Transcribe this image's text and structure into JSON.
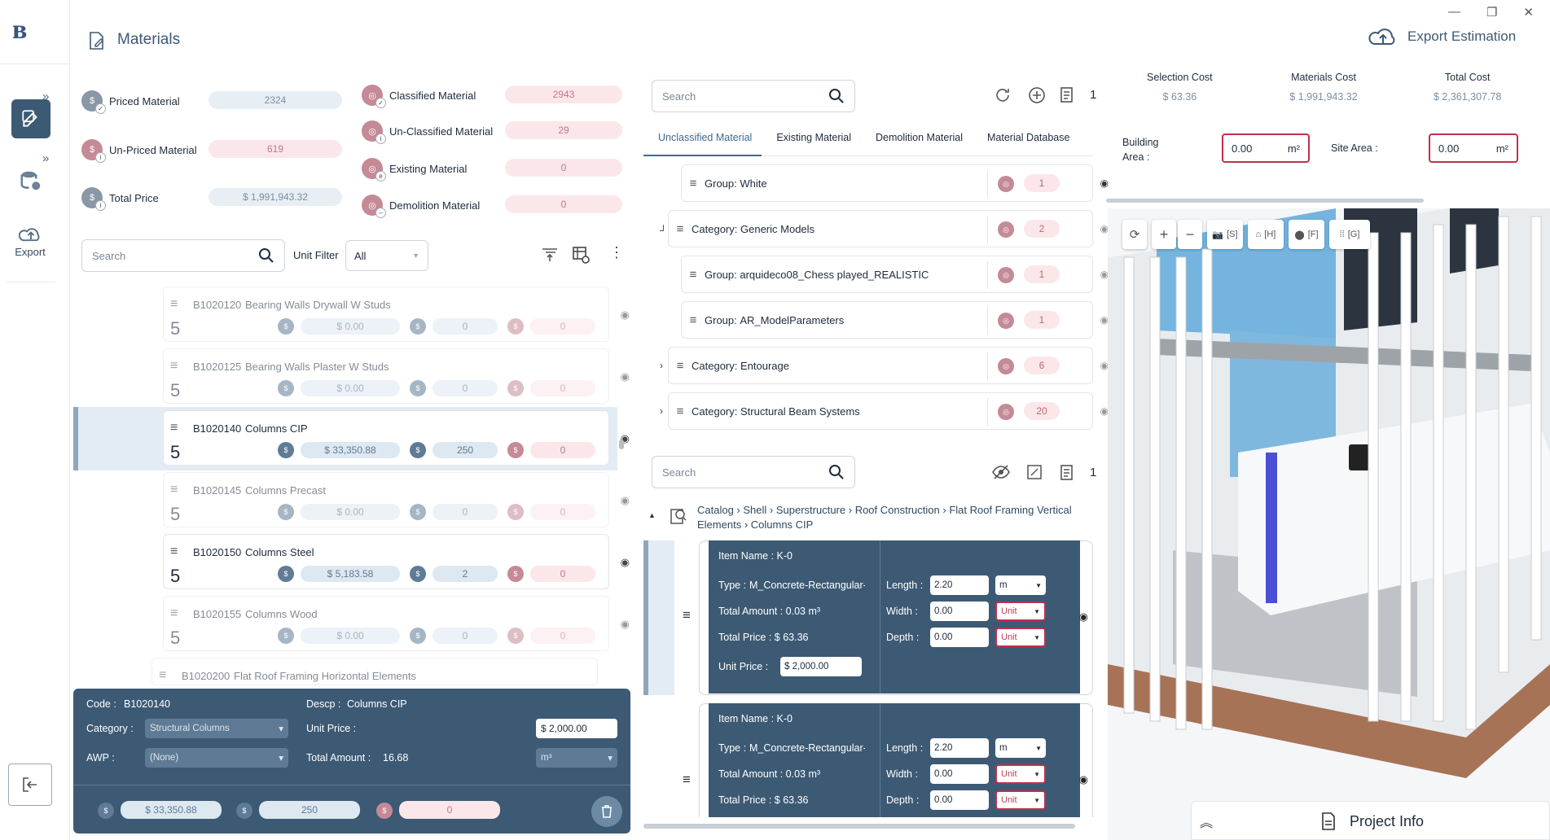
{
  "window": {
    "minimize": "—",
    "restore": "❐",
    "close": "✕"
  },
  "sidebar": {
    "export_label": "Export"
  },
  "header": {
    "title": "Materials",
    "export_label": "Export Estimation"
  },
  "stats": {
    "priced": {
      "label": "Priced Material",
      "value": "2324"
    },
    "unpriced": {
      "label": "Un-Priced Material",
      "value": "619"
    },
    "total_price": {
      "label": "Total Price",
      "value": "$ 1,991,943.32"
    },
    "classified": {
      "label": "Classified Material",
      "value": "2943"
    },
    "unclassified": {
      "label": "Un-Classified Material",
      "value": "29"
    },
    "existing": {
      "label": "Existing Material",
      "value": "0"
    },
    "demolition": {
      "label": "Demolition Material",
      "value": "0"
    }
  },
  "filters": {
    "search_placeholder": "Search",
    "unit_filter_label": "Unit Filter",
    "unit_filter_value": "All"
  },
  "materials": [
    {
      "code": "B1020120",
      "desc": "Bearing Walls Drywall W Studs",
      "level": "5",
      "price": "$ 0.00",
      "count": "0",
      "unpriced": "0"
    },
    {
      "code": "B1020125",
      "desc": "Bearing Walls Plaster W Studs",
      "level": "5",
      "price": "$ 0.00",
      "count": "0",
      "unpriced": "0"
    },
    {
      "code": "B1020140",
      "desc": "Columns CIP",
      "level": "5",
      "price": "$ 33,350.88",
      "count": "250",
      "unpriced": "0"
    },
    {
      "code": "B1020145",
      "desc": "Columns Precast",
      "level": "5",
      "price": "$ 0.00",
      "count": "0",
      "unpriced": "0"
    },
    {
      "code": "B1020150",
      "desc": "Columns Steel",
      "level": "5",
      "price": "$ 5,183.58",
      "count": "2",
      "unpriced": "0"
    },
    {
      "code": "B1020155",
      "desc": "Columns Wood",
      "level": "5",
      "price": "$ 0.00",
      "count": "0",
      "unpriced": "0"
    },
    {
      "code": "B1020200",
      "desc": "Flat Roof Framing Horizontal Elements"
    }
  ],
  "detail": {
    "code_label": "Code :",
    "code": "B1020140",
    "descp_label": "Descp :",
    "descp": "Columns CIP",
    "category_label": "Category :",
    "category": "Structural Columns",
    "awp_label": "AWP :",
    "awp": "(None)",
    "unit_price_label": "Unit Price :",
    "unit_price": "$ 2,000.00",
    "total_amount_label": "Total Amount :",
    "total_amount": "16.68",
    "unit": "m³",
    "footer_price": "$ 33,350.88",
    "footer_count": "250",
    "footer_unpriced": "0"
  },
  "tree": {
    "search_placeholder": "Search",
    "page_indicator": "1",
    "tabs": [
      "Unclassified Material",
      "Existing Material",
      "Demolition Material",
      "Material Database"
    ],
    "rows": [
      {
        "label": "Group:",
        "name": "White",
        "count": "1"
      },
      {
        "label": "Category:",
        "name": "Generic Models",
        "count": "2"
      },
      {
        "label": "Group:",
        "name": "arquideco08_Chess played_REALISTIC",
        "count": "1"
      },
      {
        "label": "Group:",
        "name": "AR_ModelParameters",
        "count": "1"
      },
      {
        "label": "Category:",
        "name": "Entourage",
        "count": "6"
      },
      {
        "label": "Category:",
        "name": "Structural Beam Systems",
        "count": "20"
      }
    ]
  },
  "items": {
    "search_placeholder": "Search",
    "page_indicator": "1",
    "breadcrumb": [
      "Catalog",
      "Shell",
      "Superstructure",
      "Roof Construction",
      "Flat Roof Framing Vertical Elements",
      "Columns CIP"
    ],
    "cards": [
      {
        "name": "Item Name : K-0",
        "type_label": "Type :",
        "type": "M_Concrete-Rectangular-C...",
        "total_amount": "Total Amount : 0.03 m³",
        "total_price": "Total Price : $ 63.36",
        "unit_price_label": "Unit Price :",
        "unit_price": "$ 2,000.00",
        "length_label": "Length :",
        "length": "2.20",
        "length_unit": "m",
        "width_label": "Width :",
        "width": "0.00",
        "width_unit": "Unit",
        "depth_label": "Depth :",
        "depth": "0.00",
        "depth_unit": "Unit"
      },
      {
        "name": "Item Name : K-0",
        "type_label": "Type :",
        "type": "M_Concrete-Rectangular-C...",
        "total_amount": "Total Amount : 0.03 m³",
        "total_price": "Total Price : $ 63.36",
        "length_label": "Length :",
        "length": "2.20",
        "length_unit": "m",
        "width_label": "Width :",
        "width": "0.00",
        "width_unit": "Unit",
        "depth_label": "Depth :",
        "depth": "0.00",
        "depth_unit": "Unit"
      }
    ]
  },
  "costs": {
    "selection": {
      "label": "Selection Cost",
      "value": "$ 63.36"
    },
    "materials": {
      "label": "Materials Cost",
      "value": "$ 1,991,943.32"
    },
    "total": {
      "label": "Total Cost",
      "value": "$ 2,361,307.78"
    }
  },
  "areas": {
    "building_label_1": "Building",
    "building_label_2": "Area :",
    "building_value": "0.00",
    "site_label": "Site Area :",
    "site_value": "0.00",
    "unit": "m²"
  },
  "viewer": {
    "btn_shot": "[S]",
    "btn_home": "[H]",
    "btn_pin": "[F]",
    "btn_grid": "[G]"
  },
  "project_info": {
    "label": "Project Info"
  }
}
